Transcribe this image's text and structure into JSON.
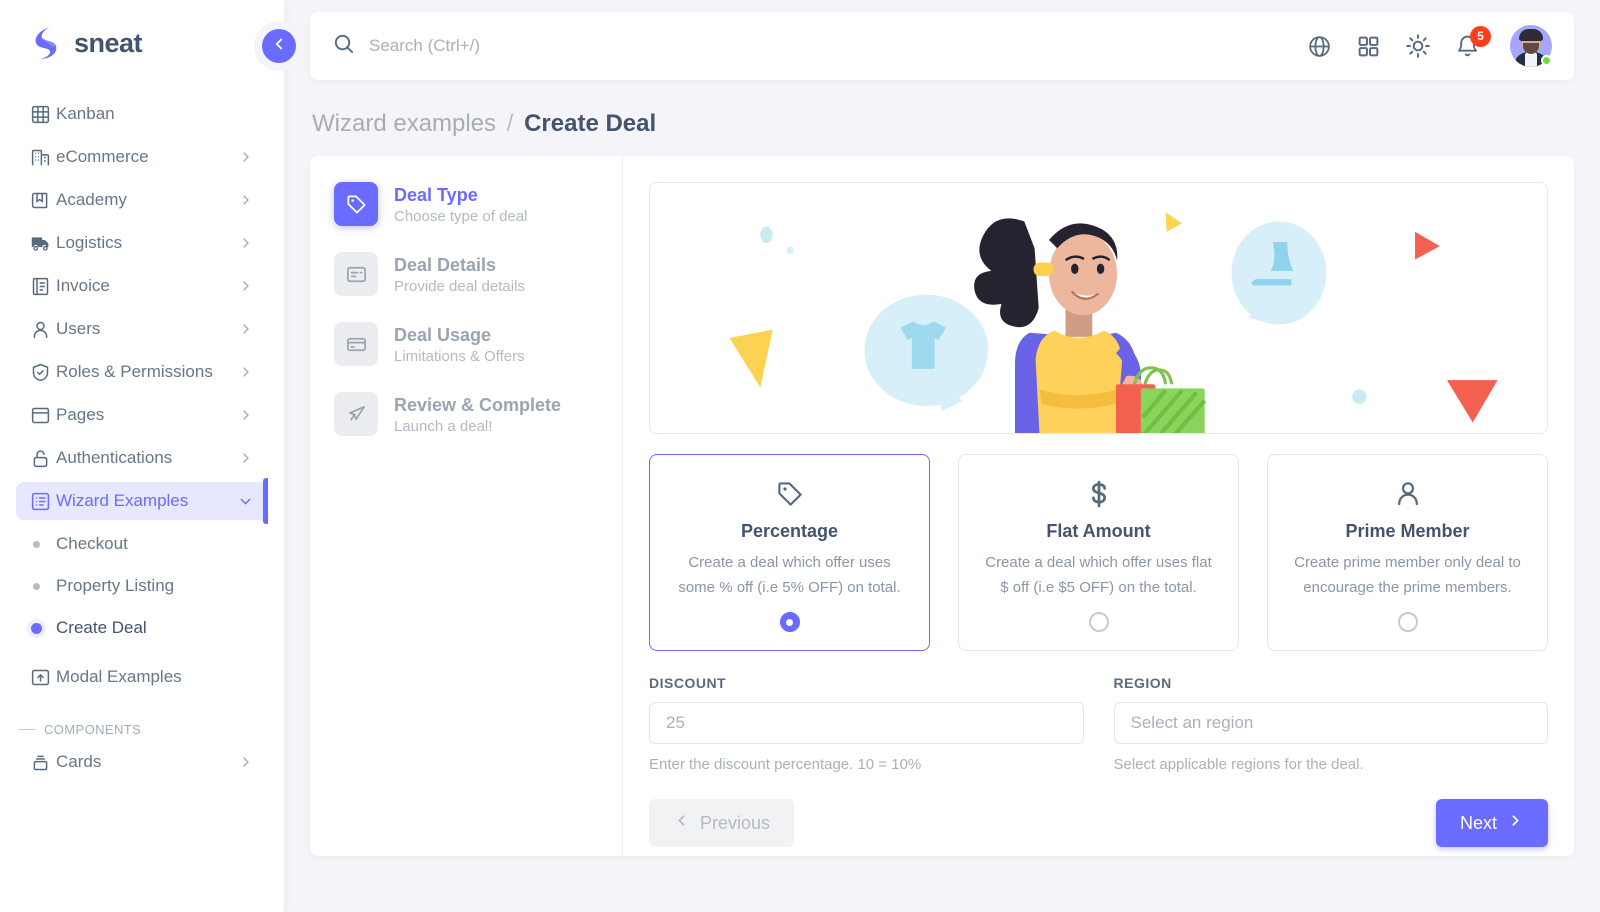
{
  "brand": {
    "name": "sneat",
    "logo_icon": "sneat-logo-icon",
    "collapse_icon": "chevron-left-icon"
  },
  "sidebar": {
    "items": [
      {
        "label": "Kanban",
        "icon": "kanban-grid-icon",
        "arrow": false
      },
      {
        "label": "eCommerce",
        "icon": "store-icon",
        "arrow": true
      },
      {
        "label": "Academy",
        "icon": "book-icon",
        "arrow": true
      },
      {
        "label": "Logistics",
        "icon": "truck-icon",
        "arrow": true
      },
      {
        "label": "Invoice",
        "icon": "invoice-icon",
        "arrow": true
      },
      {
        "label": "Users",
        "icon": "user-icon",
        "arrow": true
      },
      {
        "label": "Roles & Permissions",
        "icon": "shield-check-icon",
        "arrow": true
      },
      {
        "label": "Pages",
        "icon": "window-icon",
        "arrow": true
      },
      {
        "label": "Authentications",
        "icon": "lock-icon",
        "arrow": true
      }
    ],
    "active_item": {
      "label": "Wizard Examples",
      "icon": "list-box-icon",
      "arrow_icon": "chevron-down-icon"
    },
    "sub_items": [
      {
        "label": "Checkout",
        "current": false
      },
      {
        "label": "Property Listing",
        "current": false
      },
      {
        "label": "Create Deal",
        "current": true
      }
    ],
    "modal_item": {
      "label": "Modal Examples",
      "icon": "modal-icon"
    },
    "section_header": "COMPONENTS",
    "components_items": [
      {
        "label": "Cards",
        "icon": "cards-icon",
        "arrow": true
      }
    ],
    "accent_color": "#696cff",
    "active_bg": "#e7e7ff"
  },
  "navbar": {
    "search": {
      "placeholder": "Search (Ctrl+/)",
      "value": "",
      "icon": "search-icon"
    },
    "actions": [
      {
        "name": "language-globe-icon"
      },
      {
        "name": "apps-grid-icon"
      },
      {
        "name": "theme-sun-icon"
      }
    ],
    "notifications": {
      "icon": "bell-icon",
      "badge": "5",
      "badge_color": "#ff3e1d"
    },
    "avatar": {
      "name": "user-avatar",
      "status": "online",
      "status_color": "#71dd37"
    }
  },
  "breadcrumb": {
    "parent": "Wizard examples",
    "separator": "/",
    "current": "Create Deal"
  },
  "wizard": {
    "steps": [
      {
        "title": "Deal Type",
        "sub": "Choose type of deal",
        "icon": "tag-icon",
        "active": true
      },
      {
        "title": "Deal Details",
        "sub": "Provide deal details",
        "icon": "document-text-icon",
        "active": false
      },
      {
        "title": "Deal Usage",
        "sub": "Limitations & Offers",
        "icon": "credit-card-icon",
        "active": false
      },
      {
        "title": "Review & Complete",
        "sub": "Launch a deal!",
        "icon": "rocket-icon",
        "active": false
      }
    ],
    "illustration": {
      "name": "shopping-woman-illustration",
      "alt": "Woman holding shopping bags with clothing speech bubbles"
    },
    "deal_types": [
      {
        "title": "Percentage",
        "desc": "Create a deal which offer uses some % off (i.e 5% OFF) on total.",
        "icon": "tag-icon",
        "selected": true
      },
      {
        "title": "Flat Amount",
        "desc": "Create a deal which offer uses flat $ off (i.e $5 OFF) on the total.",
        "icon": "dollar-icon",
        "selected": false
      },
      {
        "title": "Prime Member",
        "desc": "Create prime member only deal to encourage the prime members.",
        "icon": "person-icon",
        "selected": false
      }
    ],
    "fields": {
      "discount": {
        "label": "DISCOUNT",
        "placeholder": "25",
        "value": "",
        "help": "Enter the discount percentage. 10 = 10%"
      },
      "region": {
        "label": "REGION",
        "placeholder": "Select an region",
        "value": "",
        "help": "Select applicable regions for the deal."
      }
    },
    "buttons": {
      "previous": {
        "label": "Previous",
        "icon": "chevron-left-icon",
        "disabled": true
      },
      "next": {
        "label": "Next",
        "icon": "chevron-right-icon",
        "disabled": false
      }
    }
  }
}
